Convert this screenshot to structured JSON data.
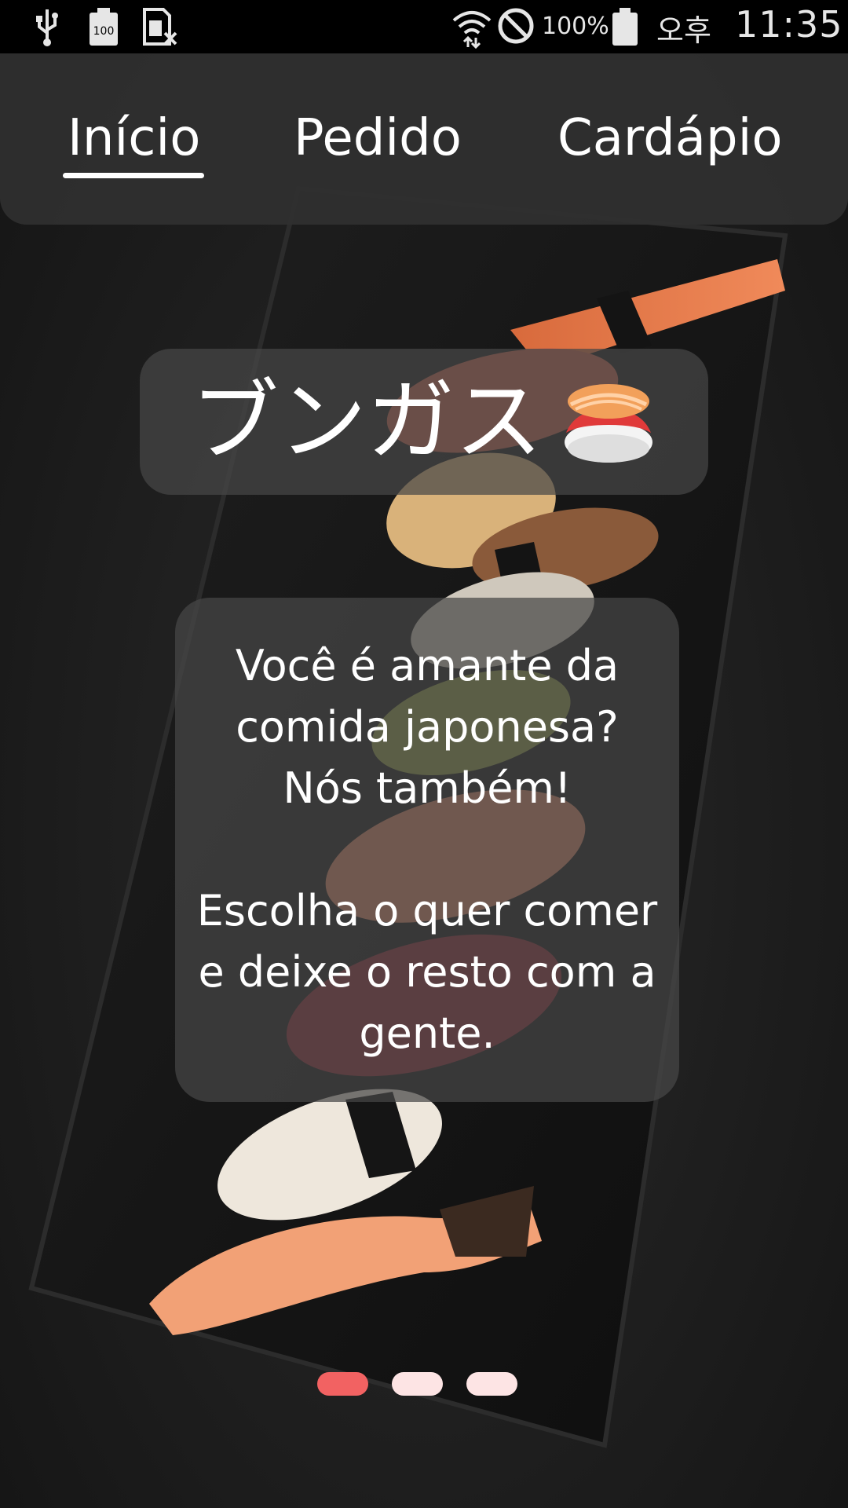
{
  "status_bar": {
    "icons": [
      "usb-icon",
      "battery-100-icon",
      "sim-card-off-icon",
      "wifi-icon",
      "do-not-disturb-icon",
      "battery-icon"
    ],
    "battery_percent": "100%",
    "ampm": "오후",
    "time": "11:35"
  },
  "nav": {
    "tabs": [
      {
        "label": "Início",
        "active": true
      },
      {
        "label": "Pedido",
        "active": false
      },
      {
        "label": "Cardápio",
        "active": false
      }
    ]
  },
  "hero": {
    "title": "ブンガス",
    "title_icon": "sushi-icon"
  },
  "intro": {
    "paragraph_1": "Você é amante da comida japonesa? Nós também!",
    "paragraph_2": "Escolha o quer comer e deixe o resto com a gente."
  },
  "carousel": {
    "page_count": 3,
    "active_index": 0,
    "active_color": "#f26262",
    "inactive_color": "#fde4e4"
  },
  "colors": {
    "nav_background": "#303030",
    "card_background": "#464646",
    "text": "#ffffff"
  }
}
